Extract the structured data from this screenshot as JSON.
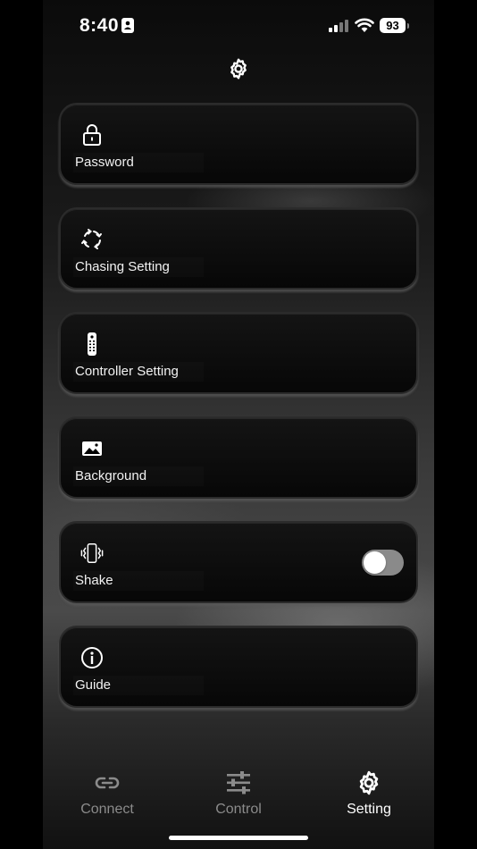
{
  "status": {
    "time": "8:40",
    "battery": "93"
  },
  "menu": [
    {
      "label": "Password",
      "icon": "lock-icon"
    },
    {
      "label": "Chasing Setting",
      "icon": "chase-arrows-icon"
    },
    {
      "label": "Controller Setting",
      "icon": "remote-control-icon"
    },
    {
      "label": "Background",
      "icon": "image-icon"
    },
    {
      "label": "Shake",
      "icon": "phone-vibrate-icon",
      "toggle_on": false
    },
    {
      "label": "Guide",
      "icon": "info-icon"
    }
  ],
  "tabs": [
    {
      "label": "Connect",
      "icon": "link-icon",
      "active": false
    },
    {
      "label": "Control",
      "icon": "sliders-icon",
      "active": false
    },
    {
      "label": "Setting",
      "icon": "gear-icon",
      "active": true
    }
  ],
  "colors": {
    "accent": "#ffffff",
    "inactive": "#8b8b8b",
    "toggle_off": "#8a8a8a"
  }
}
